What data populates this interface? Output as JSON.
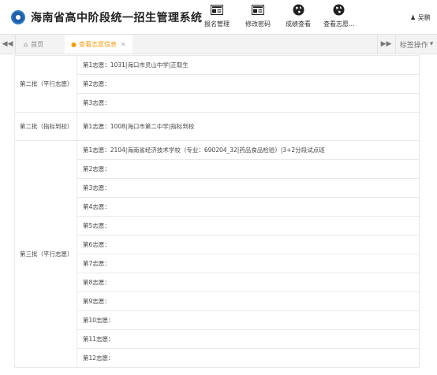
{
  "app": {
    "title": "海南省高中阶段统一招生管理系统",
    "user": "吴鹏"
  },
  "nav": [
    {
      "label": "报名管理",
      "icon": "id-card-icon"
    },
    {
      "label": "修改密码",
      "icon": "id-card-icon"
    },
    {
      "label": "成绩查看",
      "icon": "globe-icon"
    },
    {
      "label": "查看志愿...",
      "icon": "globe-icon"
    }
  ],
  "tabbar": {
    "home": "首页",
    "active_tab": "查看志愿信息",
    "ops": "标签操作"
  },
  "batches": [
    {
      "name": "第二批（平行志愿）",
      "choices": [
        "第1志愿：1031|海口市灵山中学|正取生",
        "第2志愿：",
        "第3志愿："
      ]
    },
    {
      "name": "第二批（指标到校）",
      "choices": [
        "第1志愿：1008|海口市第二中学|指标到校"
      ]
    },
    {
      "name": "第三批（平行志愿）",
      "choices": [
        "第1志愿：2104|海南省经济技术学校（专业：690204_32|药品食品检验）|3+2分段试点班",
        "第2志愿：",
        "第3志愿：",
        "第4志愿：",
        "第5志愿：",
        "第6志愿：",
        "第7志愿：",
        "第8志愿：",
        "第9志愿：",
        "第10志愿：",
        "第11志愿：",
        "第12志愿："
      ]
    }
  ]
}
